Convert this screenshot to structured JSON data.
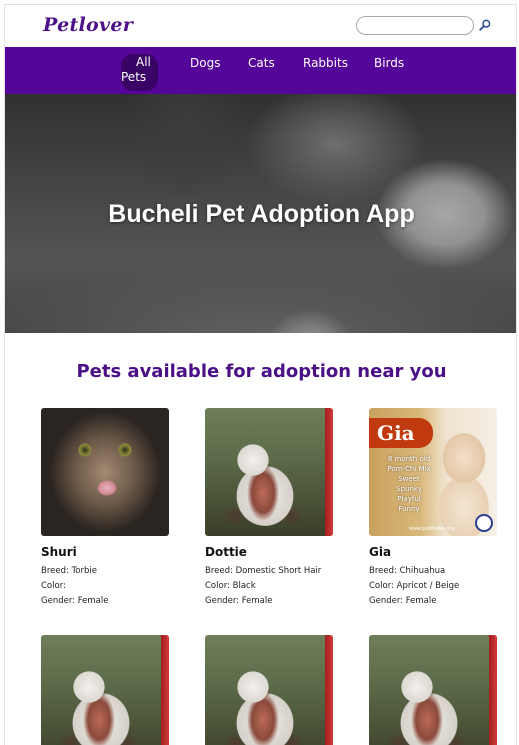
{
  "brand": {
    "logo": "Petlover"
  },
  "search": {
    "placeholder": "",
    "value": ""
  },
  "nav": {
    "items": [
      {
        "label_line1": "All",
        "label_line2": "Pets",
        "active": true
      },
      {
        "label": "Dogs"
      },
      {
        "label": "Cats"
      },
      {
        "label": "Rabbits"
      },
      {
        "label": "Birds"
      }
    ],
    "background": "#55059a",
    "active_background": "#3a0466"
  },
  "hero": {
    "title": "Bucheli Pet Adoption App"
  },
  "section": {
    "title": "Pets available for adoption near you"
  },
  "labels": {
    "breed": "Breed:",
    "color": "Color:",
    "gender": "Gender:"
  },
  "pets": [
    {
      "name": "Shuri",
      "breed": "Torbie",
      "color": "",
      "gender": "Female",
      "photo": "tabby-cat-photo"
    },
    {
      "name": "Dottie",
      "breed": "Domestic Short Hair",
      "color": "Black",
      "gender": "Female",
      "photo": "teddy-bear-photo"
    },
    {
      "name": "Gia",
      "breed": "Chihuahua",
      "color": "Apricot / Beige",
      "gender": "Female",
      "photo": "chihuahua-poster-photo",
      "poster": {
        "name": "Gia",
        "lines": [
          "8 month old",
          "Pom-Chi Mix",
          "Sweet",
          "Spunky",
          "Playful",
          "Funny"
        ],
        "footer": "www.petfinder.org"
      }
    },
    {
      "photo": "teddy-bear-photo"
    },
    {
      "photo": "teddy-bear-photo"
    },
    {
      "photo": "teddy-bear-photo"
    }
  ],
  "colors": {
    "brand": "#4b0f87",
    "nav": "#55059a"
  }
}
